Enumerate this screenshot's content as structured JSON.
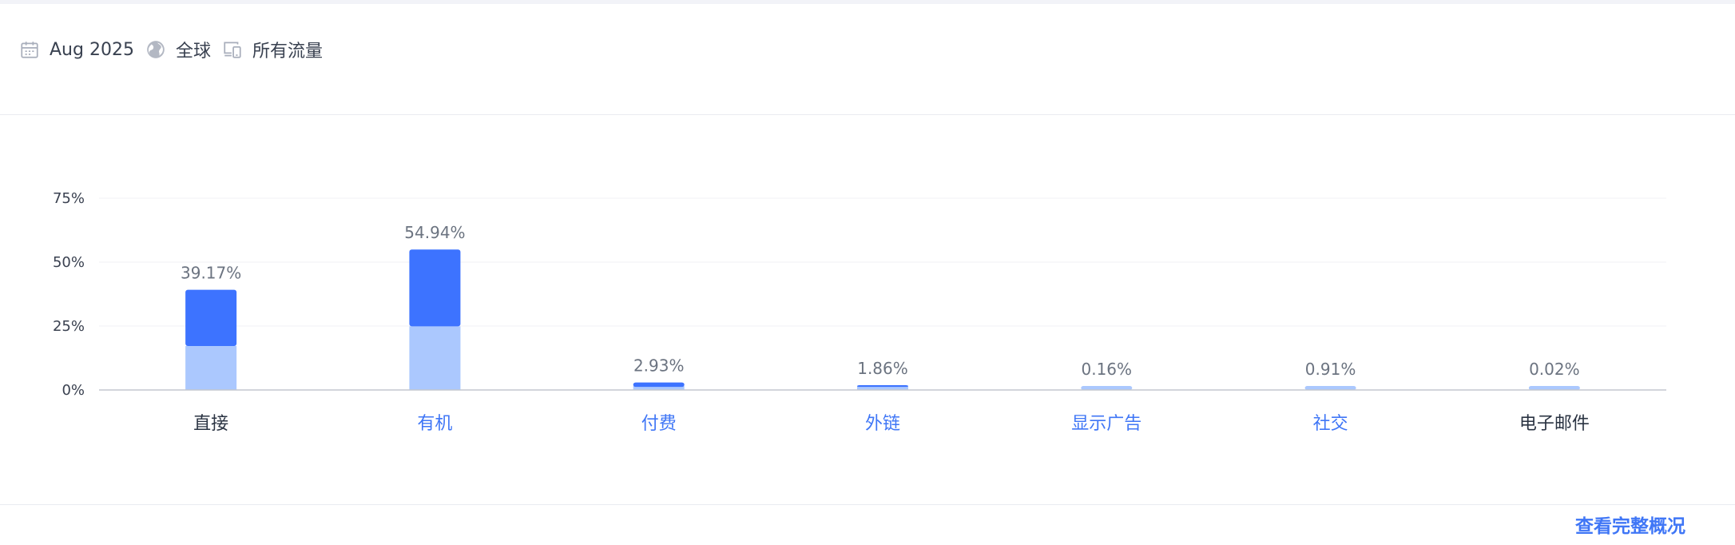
{
  "filters": {
    "date": "Aug 2025",
    "region": "全球",
    "traffic": "所有流量"
  },
  "icons": {
    "date": "calendar-icon",
    "region": "globe-icon",
    "traffic": "devices-icon"
  },
  "colors": {
    "bar_dark": "#3d73ff",
    "bar_light": "#abc8fe",
    "link": "#3f76f6",
    "text": "#2a3342",
    "axis": "#c3c7cf"
  },
  "footer": {
    "view_full_label": "查看完整概况"
  },
  "chart_data": {
    "type": "bar",
    "stacked": true,
    "categories": [
      "直接",
      "有机",
      "付费",
      "外链",
      "显示广告",
      "社交",
      "电子邮件"
    ],
    "category_links": [
      false,
      true,
      true,
      true,
      true,
      true,
      false
    ],
    "series": [
      {
        "values": [
          17.2,
          24.9,
          1.2,
          1.2,
          0.16,
          0.91,
          0.02
        ]
      },
      {
        "values": [
          21.97,
          30.04,
          1.73,
          0.66,
          0.0,
          0.0,
          0.0
        ]
      }
    ],
    "totals": [
      "39.17%",
      "54.94%",
      "2.93%",
      "1.86%",
      "0.16%",
      "0.91%",
      "0.02%"
    ],
    "yticks": [
      "0%",
      "25%",
      "50%",
      "75%"
    ],
    "ylim": [
      0,
      75
    ],
    "grid": true
  }
}
